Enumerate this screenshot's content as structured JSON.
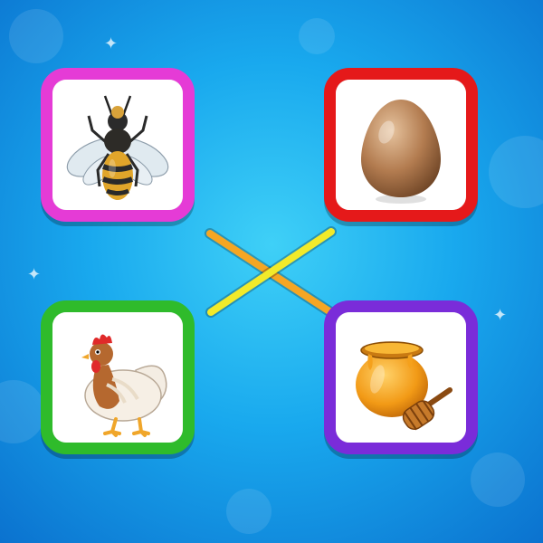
{
  "game": {
    "type": "match-the-pairs",
    "cards": [
      {
        "id": "bee",
        "subject": "bee",
        "border_color": "#e53bd6",
        "icon": "bee-icon"
      },
      {
        "id": "egg",
        "subject": "egg",
        "border_color": "#e5191a",
        "icon": "egg-icon"
      },
      {
        "id": "hen",
        "subject": "hen",
        "border_color": "#2fbb2b",
        "icon": "hen-icon"
      },
      {
        "id": "honey",
        "subject": "honey pot",
        "border_color": "#7a2cd9",
        "icon": "honey-pot-icon"
      }
    ],
    "connections": [
      {
        "from": "bee",
        "to": "honey",
        "color": "#f5a623"
      },
      {
        "from": "hen",
        "to": "egg",
        "color": "#f2ea2a"
      }
    ]
  },
  "theme": {
    "background": [
      "#3fd0f7",
      "#19a9ee",
      "#0b72cf"
    ]
  }
}
